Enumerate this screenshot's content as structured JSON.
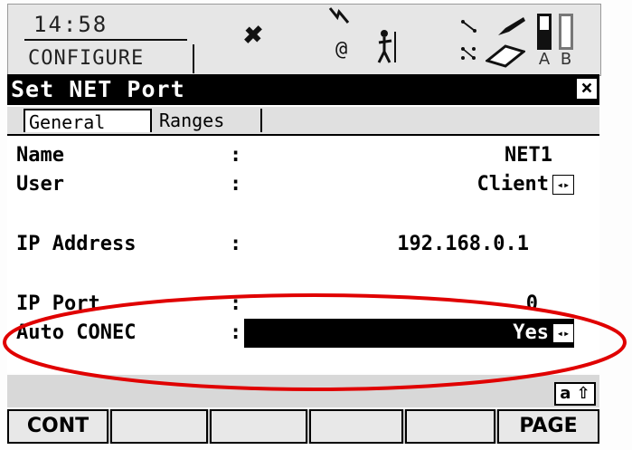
{
  "status": {
    "time": "14:58",
    "app_name": "CONFIGURE",
    "icons": [
      "satellite-icon",
      "radio-signal-icon",
      "at-icon",
      "person-with-pole-icon",
      "line-icon",
      "grid-icon",
      "pencil-icon",
      "eraser-icon"
    ],
    "battery_a_label": "A",
    "battery_b_label": "B"
  },
  "window": {
    "title": "Set NET Port",
    "close_glyph": "×"
  },
  "tabs": [
    {
      "label": "General",
      "active": true
    },
    {
      "label": "Ranges",
      "active": false
    }
  ],
  "fields": [
    {
      "label": "Name",
      "colon": ":",
      "value": "NET1"
    },
    {
      "label": "User",
      "colon": ":",
      "value": "Client"
    },
    {
      "label": "IP Address",
      "colon": ":",
      "value": "192.168.0.1"
    },
    {
      "label": "IP Port",
      "colon": ":",
      "value": "0"
    },
    {
      "label": "Auto CONEC",
      "colon": ":",
      "value": "Yes"
    }
  ],
  "input_mode": "a ⇧",
  "softkeys": [
    "CONT",
    "",
    "",
    "",
    "",
    "PAGE"
  ],
  "colors": {
    "annotation": "#e00000",
    "title_bg": "#000000",
    "selected_bg": "#000000"
  }
}
